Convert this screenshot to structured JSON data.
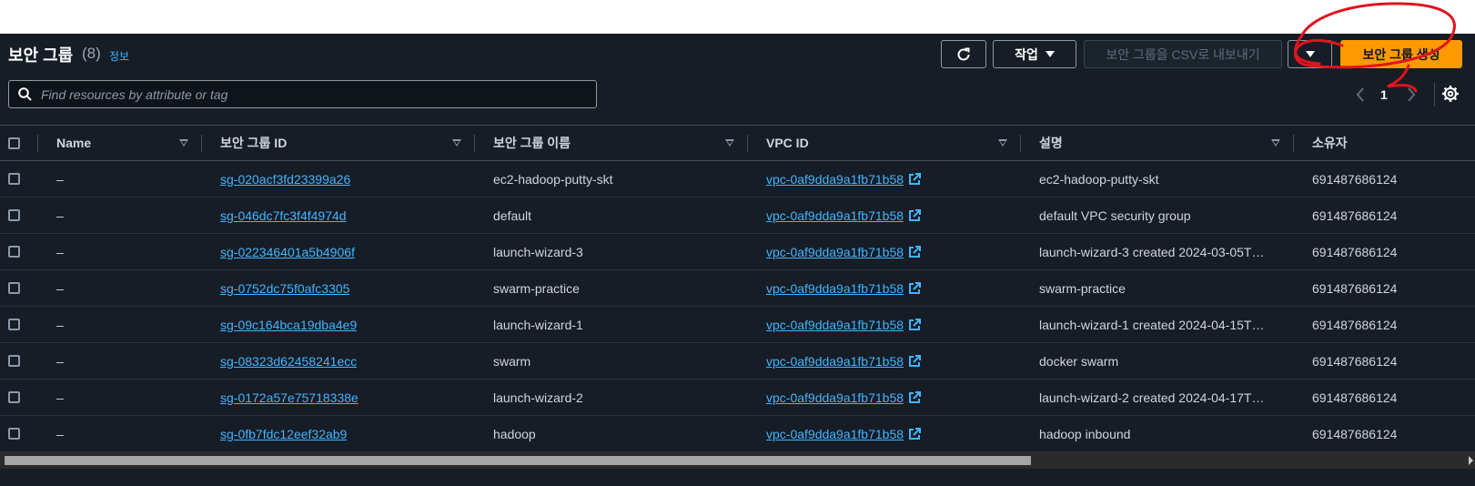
{
  "header": {
    "title": "보안 그룹",
    "count": "(8)",
    "info_link": "정보"
  },
  "toolbar": {
    "refresh_icon": "refresh-icon",
    "actions_label": "작업",
    "export_csv_label": "보안 그룹을 CSV로 내보내기",
    "create_label": "보안 그룹 생성"
  },
  "search": {
    "placeholder": "Find resources by attribute or tag"
  },
  "pagination": {
    "current_page": "1"
  },
  "table": {
    "columns": [
      "Name",
      "보안 그룹 ID",
      "보안 그룹 이름",
      "VPC ID",
      "설명",
      "소유자"
    ],
    "rows": [
      {
        "name": "–",
        "sg_id": "sg-020acf3fd23399a26",
        "sg_name": "ec2-hadoop-putty-skt",
        "vpc_id": "vpc-0af9dda9a1fb71b58",
        "description": "ec2-hadoop-putty-skt",
        "owner": "691487686124"
      },
      {
        "name": "–",
        "sg_id": "sg-046dc7fc3f4f4974d",
        "sg_name": "default",
        "vpc_id": "vpc-0af9dda9a1fb71b58",
        "description": "default VPC security group",
        "owner": "691487686124"
      },
      {
        "name": "–",
        "sg_id": "sg-022346401a5b4906f",
        "sg_name": "launch-wizard-3",
        "vpc_id": "vpc-0af9dda9a1fb71b58",
        "description": "launch-wizard-3 created 2024-03-05T…",
        "owner": "691487686124"
      },
      {
        "name": "–",
        "sg_id": "sg-0752dc75f0afc3305",
        "sg_name": "swarm-practice",
        "vpc_id": "vpc-0af9dda9a1fb71b58",
        "description": "swarm-practice",
        "owner": "691487686124"
      },
      {
        "name": "–",
        "sg_id": "sg-09c164bca19dba4e9",
        "sg_name": "launch-wizard-1",
        "vpc_id": "vpc-0af9dda9a1fb71b58",
        "description": "launch-wizard-1 created 2024-04-15T…",
        "owner": "691487686124"
      },
      {
        "name": "–",
        "sg_id": "sg-08323d62458241ecc",
        "sg_name": "swarm",
        "vpc_id": "vpc-0af9dda9a1fb71b58",
        "description": "docker swarm",
        "owner": "691487686124"
      },
      {
        "name": "–",
        "sg_id": "sg-0172a57e75718338e",
        "sg_name": "launch-wizard-2",
        "vpc_id": "vpc-0af9dda9a1fb71b58",
        "description": "launch-wizard-2 created 2024-04-17T…",
        "owner": "691487686124"
      },
      {
        "name": "–",
        "sg_id": "sg-0fb7fdc12eef32ab9",
        "sg_name": "hadoop",
        "vpc_id": "vpc-0af9dda9a1fb71b58",
        "description": "hadoop inbound",
        "owner": "691487686124"
      }
    ]
  },
  "colors": {
    "background": "#161d26",
    "link": "#42b4ff",
    "primary_button": "#ff9900",
    "annotation": "#e0141e"
  }
}
